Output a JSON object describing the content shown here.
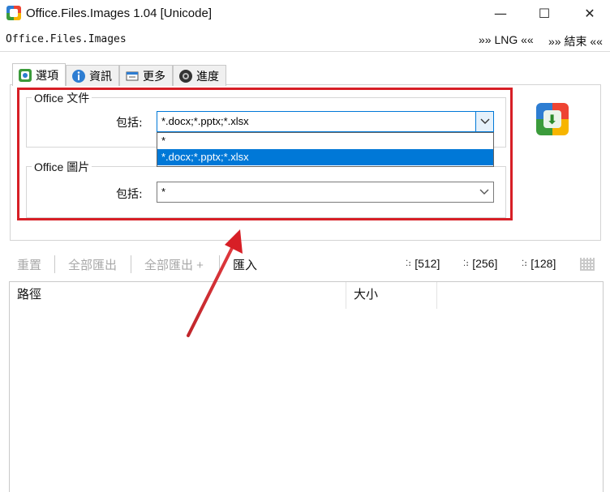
{
  "window": {
    "title": "Office.Files.Images 1.04 [Unicode]",
    "minimize": "—",
    "maximize": "☐",
    "close": "✕"
  },
  "menu": {
    "brand": "Office.Files.Images",
    "lng": "»» LNG ««",
    "exit": "»» 結束 ««"
  },
  "tabs": [
    {
      "label": "選項",
      "icon": "options-icon",
      "active": true
    },
    {
      "label": "資訊",
      "icon": "info-icon",
      "active": false
    },
    {
      "label": "更多",
      "icon": "more-icon",
      "active": false
    },
    {
      "label": "進度",
      "icon": "progress-icon",
      "active": false
    }
  ],
  "office_docs": {
    "group_title": "Office 文件",
    "include_label": "包括:",
    "include_value": "*.docx;*.pptx;*.xlsx",
    "dropdown_options": [
      "*",
      "*.docx;*.pptx;*.xlsx"
    ],
    "selected_option": "*.docx;*.pptx;*.xlsx"
  },
  "office_images": {
    "group_title": "Office 圖片",
    "include_label": "包括:",
    "include_value": "*"
  },
  "toolbar": {
    "reset": "重置",
    "export_all": "全部匯出",
    "export_all_plus": "全部匯出 +",
    "import": "匯入",
    "size_512": "[512]",
    "size_256": "[256]",
    "size_128": "[128]"
  },
  "list": {
    "columns": [
      "路徑",
      "大小"
    ],
    "rows": []
  },
  "colors": {
    "annotation_red": "#d71f26",
    "selection_blue": "#0078d7"
  }
}
